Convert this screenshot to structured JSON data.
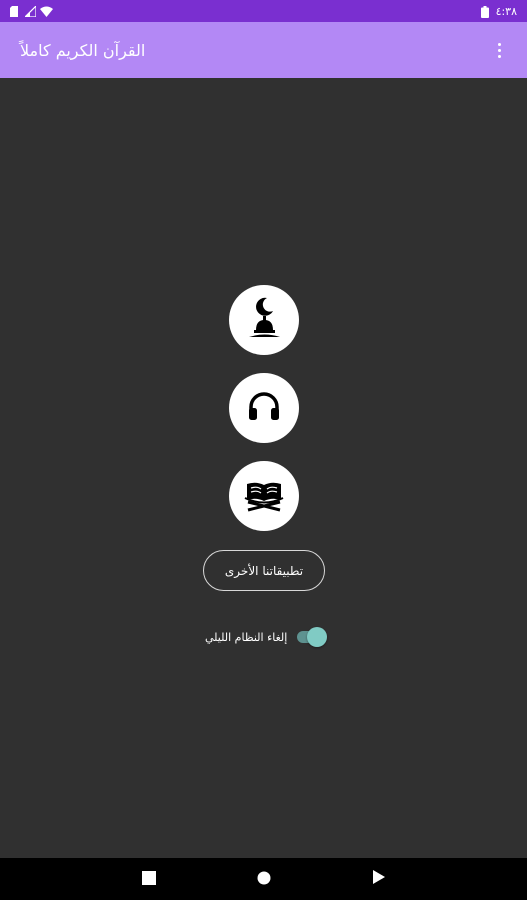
{
  "status_bar": {
    "time": "٤:٣٨",
    "icons": [
      "sim-icon",
      "signal-icon",
      "wifi-icon",
      "battery-icon"
    ]
  },
  "app_bar": {
    "title": "القرآن الكريم كاملاً",
    "menu_icon": "more-vertical-icon"
  },
  "main": {
    "buttons": [
      {
        "icon": "mosque-crescent-icon"
      },
      {
        "icon": "headphones-icon"
      },
      {
        "icon": "quran-book-icon"
      }
    ],
    "other_apps_label": "تطبيقاتنا الأخرى",
    "night_mode_label": "إلغاء النظام الليلي",
    "night_mode_enabled": true
  },
  "nav_bar": {
    "icons": [
      "recents-square-icon",
      "home-circle-icon",
      "back-triangle-icon"
    ]
  },
  "colors": {
    "status_bar": "#7a2fd0",
    "app_bar": "#b388f5",
    "background": "#303030",
    "toggle_accent": "#80cbc4"
  }
}
